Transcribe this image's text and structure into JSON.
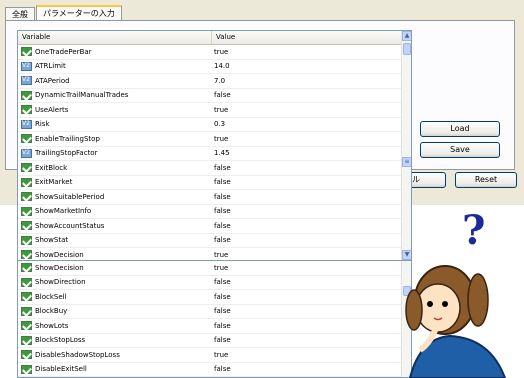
{
  "tabs": [
    "全般",
    "パラメーターの入力"
  ],
  "columns": {
    "variable": "Variable",
    "value": "Value"
  },
  "buttons": {
    "load": "Load",
    "save": "Save",
    "cancel": "ンセル",
    "reset": "Reset"
  },
  "grid1": [
    {
      "name": "OneTradePerBar",
      "value": "true",
      "type": "bool"
    },
    {
      "name": "ATRLimit",
      "value": "14.0",
      "type": "num"
    },
    {
      "name": "ATAPeriod",
      "value": "7.0",
      "type": "num"
    },
    {
      "name": "DynamicTrailManualTrades",
      "value": "false",
      "type": "bool"
    },
    {
      "name": "UseAlerts",
      "value": "true",
      "type": "bool"
    },
    {
      "name": "Risk",
      "value": "0.3",
      "type": "num"
    },
    {
      "name": "EnableTrailingStop",
      "value": "true",
      "type": "bool"
    },
    {
      "name": "TrailingStopFactor",
      "value": "1.45",
      "type": "num"
    },
    {
      "name": "ExitBlock",
      "value": "false",
      "type": "bool"
    },
    {
      "name": "ExitMarket",
      "value": "false",
      "type": "bool"
    },
    {
      "name": "ShowSuitablePeriod",
      "value": "false",
      "type": "bool"
    },
    {
      "name": "ShowMarketInfo",
      "value": "false",
      "type": "bool"
    },
    {
      "name": "ShowAccountStatus",
      "value": "false",
      "type": "bool"
    },
    {
      "name": "ShowStat",
      "value": "false",
      "type": "bool"
    },
    {
      "name": "ShowDecision",
      "value": "true",
      "type": "bool"
    }
  ],
  "grid2": [
    {
      "name": "ShowDecision",
      "value": "true",
      "type": "bool"
    },
    {
      "name": "ShowDirection",
      "value": "false",
      "type": "bool"
    },
    {
      "name": "BlockSell",
      "value": "false",
      "type": "bool"
    },
    {
      "name": "BlockBuy",
      "value": "false",
      "type": "bool"
    },
    {
      "name": "ShowLots",
      "value": "false",
      "type": "bool"
    },
    {
      "name": "BlockStopLoss",
      "value": "false",
      "type": "bool"
    },
    {
      "name": "DisableShadowStopLoss",
      "value": "true",
      "type": "bool"
    },
    {
      "name": "DisableExitSell",
      "value": "false",
      "type": "bool"
    }
  ],
  "icons": {
    "bool": "checkmark-green-icon",
    "num": "v2-number-icon"
  },
  "illustration": {
    "question_mark": "?"
  }
}
